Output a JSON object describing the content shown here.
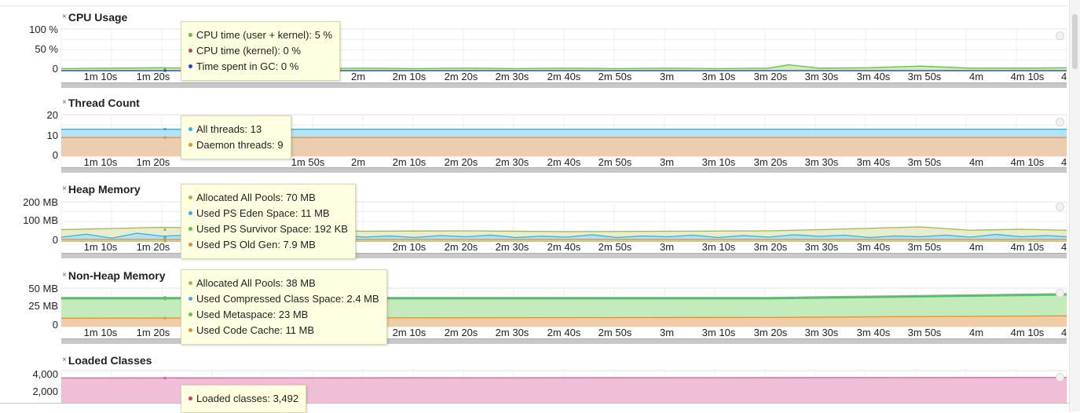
{
  "colors": {
    "green": "#5cc83a",
    "green_fill": "#c6ecb2",
    "cyan": "#2cb3e8",
    "cyan_fill": "#a8def4",
    "orange": "#f08a2a",
    "orange_fill": "#f7c9a3",
    "olive": "#a3b64a",
    "olive_fill": "#e4eac6",
    "red": "#e0325a",
    "blue": "#2240d8",
    "pink": "#d9609b",
    "pink_fill": "#eeb3d0",
    "tooltip_bg": "#ffffe1"
  },
  "x_ticks": [
    "1m 10s",
    "1m 20s",
    "1m 30s",
    "1m 40s",
    "1m 50s",
    "2m",
    "2m 10s",
    "2m 20s",
    "2m 30s",
    "2m 40s",
    "2m 50s",
    "3m",
    "3m 10s",
    "3m 20s",
    "3m 30s",
    "3m 40s",
    "3m 50s",
    "4m",
    "4m 10s",
    "4"
  ],
  "chart_data": [
    {
      "type": "area",
      "title": "CPU Usage",
      "y_ticks": [
        "100 %",
        "50 %",
        "0"
      ],
      "ylim": [
        0,
        100
      ],
      "xlim": [
        60,
        259
      ],
      "x_ticks": [
        "1m 10s",
        "1m 20s",
        "2m",
        "2m 10s",
        "2m 20s",
        "2m 30s",
        "2m 40s",
        "2m 50s",
        "3m",
        "3m 10s",
        "3m 20s",
        "3m 30s",
        "3m 40s",
        "3m 50s",
        "4m",
        "4m 10s"
      ],
      "tooltip": {
        "rows": [
          {
            "label": "CPU time (user + kernel): 5 %",
            "color": "green"
          },
          {
            "label": "CPU time (kernel): 0 %",
            "color": "red"
          },
          {
            "label": "Time spent in GC: 0 %",
            "color": "blue"
          }
        ]
      },
      "series": [
        {
          "name": "CPU time (user + kernel)",
          "color": "green",
          "x": [
            60,
            70,
            80,
            90,
            100,
            110,
            120,
            130,
            140,
            150,
            160,
            170,
            180,
            190,
            200,
            204,
            210,
            220,
            230,
            240,
            250,
            259
          ],
          "values": [
            5,
            6,
            7,
            5,
            6,
            5,
            6,
            5,
            6,
            5,
            6,
            5,
            6,
            5,
            6,
            14,
            6,
            7,
            11,
            6,
            6,
            7
          ]
        },
        {
          "name": "CPU time (kernel)",
          "color": "red",
          "x": [
            60,
            259
          ],
          "values": [
            0,
            0
          ]
        },
        {
          "name": "Time spent in GC",
          "color": "blue",
          "x": [
            60,
            259
          ],
          "values": [
            0,
            0
          ]
        }
      ]
    },
    {
      "type": "area",
      "title": "Thread Count",
      "y_ticks": [
        "20",
        "10",
        "0"
      ],
      "ylim": [
        0,
        20
      ],
      "xlim": [
        60,
        259
      ],
      "x_ticks": [
        "1m 10s",
        "1m 20s",
        "1m 50s",
        "2m",
        "2m 10s",
        "2m 20s",
        "2m 30s",
        "2m 40s",
        "2m 50s",
        "3m",
        "3m 10s",
        "3m 20s",
        "3m 30s",
        "3m 40s",
        "3m 50s",
        "4m",
        "4m 10s"
      ],
      "tooltip": {
        "rows": [
          {
            "label": "All threads: 13",
            "color": "cyan"
          },
          {
            "label": "Daemon threads: 9",
            "color": "orange"
          }
        ]
      },
      "series": [
        {
          "name": "All threads",
          "color": "cyan",
          "x": [
            60,
            259
          ],
          "values": [
            13,
            13
          ]
        },
        {
          "name": "Daemon threads",
          "color": "orange",
          "x": [
            60,
            259
          ],
          "values": [
            9,
            9
          ]
        }
      ]
    },
    {
      "type": "area",
      "title": "Heap Memory",
      "y_ticks": [
        "200 MB",
        "100 MB",
        "0"
      ],
      "ylim": [
        0,
        200
      ],
      "xlim": [
        60,
        259
      ],
      "x_ticks": [
        "1m 10s",
        "1m 20s",
        "2m 10s",
        "2m 20s",
        "2m 30s",
        "2m 40s",
        "2m 50s",
        "3m",
        "3m 10s",
        "3m 20s",
        "3m 30s",
        "3m 40s",
        "3m 50s",
        "4m",
        "4m 10s"
      ],
      "tooltip": {
        "rows": [
          {
            "label": "Allocated All Pools: 70 MB",
            "color": "olive"
          },
          {
            "label": "Used PS Eden Space: 11 MB",
            "color": "cyan"
          },
          {
            "label": "Used PS Survivor Space: 192 KB",
            "color": "green"
          },
          {
            "label": "Used PS Old Gen: 7.9 MB",
            "color": "orange"
          }
        ]
      },
      "series": [
        {
          "name": "Allocated All Pools",
          "color": "olive",
          "x": [
            60,
            80,
            100,
            120,
            140,
            160,
            180,
            200,
            210,
            230,
            240,
            250,
            259
          ],
          "values": [
            58,
            70,
            62,
            50,
            52,
            48,
            50,
            52,
            58,
            72,
            55,
            60,
            55
          ]
        },
        {
          "name": "Used PS Eden Space",
          "color": "cyan",
          "x": [
            60,
            65,
            70,
            75,
            80,
            85,
            90,
            95,
            100,
            105,
            110,
            115,
            120,
            125,
            130,
            135,
            140,
            145,
            150,
            155,
            160,
            165,
            170,
            175,
            180,
            185,
            190,
            195,
            200,
            205,
            210,
            215,
            220,
            225,
            230,
            235,
            240,
            245,
            250,
            255,
            259
          ],
          "values": [
            20,
            35,
            15,
            40,
            25,
            30,
            18,
            32,
            22,
            28,
            16,
            30,
            20,
            26,
            18,
            28,
            22,
            30,
            18,
            25,
            20,
            32,
            18,
            26,
            22,
            30,
            18,
            28,
            20,
            32,
            24,
            30,
            18,
            26,
            22,
            30,
            20,
            34,
            22,
            28,
            22
          ]
        },
        {
          "name": "Used PS Survivor Space",
          "color": "green",
          "x": [
            60,
            259
          ],
          "values": [
            0.2,
            0.2
          ]
        },
        {
          "name": "Used PS Old Gen",
          "color": "orange",
          "x": [
            60,
            259
          ],
          "values": [
            7.9,
            7.9
          ]
        }
      ]
    },
    {
      "type": "area",
      "title": "Non-Heap Memory",
      "y_ticks": [
        "50 MB",
        "25 MB",
        "0"
      ],
      "ylim": [
        0,
        50
      ],
      "xlim": [
        60,
        259
      ],
      "x_ticks": [
        "1m 10s",
        "1m 20s",
        "2m 10s",
        "2m 20s",
        "2m 30s",
        "2m 40s",
        "2m 50s",
        "3m",
        "3m 10s",
        "3m 20s",
        "3m 30s",
        "3m 40s",
        "3m 50s",
        "4m",
        "4m 10s"
      ],
      "tooltip": {
        "rows": [
          {
            "label": "Allocated All Pools: 38 MB",
            "color": "olive"
          },
          {
            "label": "Used Compressed Class Space: 2.4 MB",
            "color": "cyan"
          },
          {
            "label": "Used Metaspace: 23 MB",
            "color": "green"
          },
          {
            "label": "Used Code Cache: 11 MB",
            "color": "orange"
          }
        ]
      },
      "series": [
        {
          "name": "Allocated All Pools",
          "color": "olive",
          "x": [
            60,
            200,
            259
          ],
          "values": [
            38,
            38,
            43
          ]
        },
        {
          "name": "Used Compressed Class Space",
          "color": "cyan",
          "x": [
            60,
            200,
            259
          ],
          "values": [
            37,
            37,
            42
          ]
        },
        {
          "name": "Used Metaspace",
          "color": "green",
          "x": [
            60,
            200,
            259
          ],
          "values": [
            36,
            36,
            41
          ]
        },
        {
          "name": "Used Code Cache",
          "color": "orange",
          "x": [
            60,
            200,
            259
          ],
          "values": [
            11,
            12,
            14
          ]
        }
      ]
    },
    {
      "type": "area",
      "title": "Loaded Classes",
      "y_ticks": [
        "4,000",
        "2,000"
      ],
      "ylim": [
        0,
        4500
      ],
      "xlim": [
        60,
        259
      ],
      "tooltip": {
        "rows": [
          {
            "label": "Loaded classes: 3,492",
            "color": "red"
          }
        ]
      },
      "series": [
        {
          "name": "Loaded classes",
          "color": "pink",
          "x": [
            60,
            259
          ],
          "values": [
            3492,
            3560
          ]
        }
      ]
    }
  ]
}
